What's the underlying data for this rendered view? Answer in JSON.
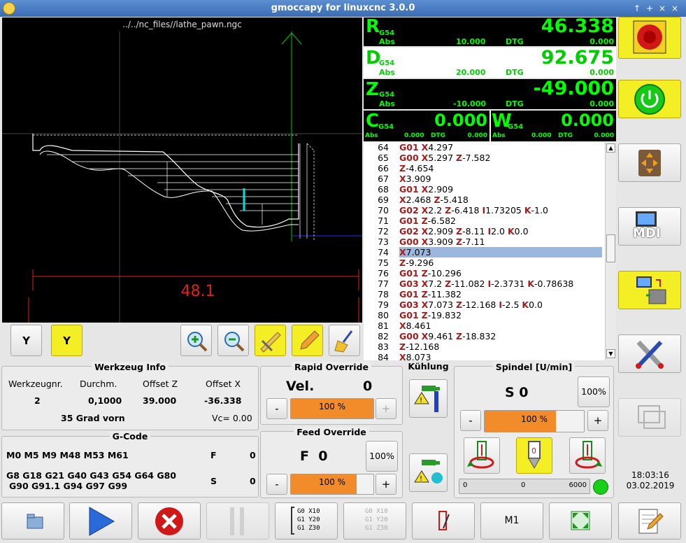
{
  "window": {
    "title": "gmoccapy for linuxcnc  3.0.0",
    "controls": [
      "↑",
      "+",
      "×",
      "×"
    ]
  },
  "preview": {
    "filename": "../../nc_files//lathe_pawn.ngc",
    "dimension": "48.1"
  },
  "dro": {
    "r": {
      "axis": "R",
      "coord": "G54",
      "abs_label": "Abs",
      "abs_value": "10.000",
      "dtg_label": "DTG",
      "value": "46.338",
      "dtg_value": "0.000"
    },
    "d": {
      "axis": "D",
      "coord": "G54",
      "abs_label": "Abs",
      "abs_value": "20.000",
      "dtg_label": "DTG",
      "value": "92.675",
      "dtg_value": "0.000"
    },
    "z": {
      "axis": "Z",
      "coord": "G54",
      "abs_label": "Abs",
      "abs_value": "-10.000",
      "dtg_label": "DTG",
      "value": "-49.000",
      "dtg_value": "0.000"
    },
    "c": {
      "axis": "C",
      "coord": "G54",
      "abs_label": "Abs",
      "abs_value": "0.000",
      "dtg_label": "DTG",
      "value": "0.000",
      "dtg_value": "0.000"
    },
    "w": {
      "axis": "W",
      "coord": "G54",
      "abs_label": "Abs",
      "abs_value": "0.000",
      "dtg_label": "DTG",
      "value": "0.000",
      "dtg_value": "0.000"
    }
  },
  "gcode_lines": [
    {
      "n": "64",
      "parts": [
        [
          "G01",
          "kw"
        ],
        [
          " ",
          ""
        ],
        [
          "X",
          "kw"
        ],
        [
          "4.297",
          ""
        ]
      ]
    },
    {
      "n": "65",
      "parts": [
        [
          "G00",
          "kw"
        ],
        [
          " ",
          ""
        ],
        [
          "X",
          "kw"
        ],
        [
          "5.297 ",
          ""
        ],
        [
          "Z",
          "kw"
        ],
        [
          "-7.582",
          ""
        ]
      ]
    },
    {
      "n": "66",
      "parts": [
        [
          "Z",
          "kw"
        ],
        [
          "-4.654",
          ""
        ]
      ]
    },
    {
      "n": "67",
      "parts": [
        [
          "X",
          "kw"
        ],
        [
          "3.909",
          ""
        ]
      ]
    },
    {
      "n": "68",
      "parts": [
        [
          "G01",
          "kw"
        ],
        [
          " ",
          ""
        ],
        [
          "X",
          "kw"
        ],
        [
          "2.909",
          ""
        ]
      ]
    },
    {
      "n": "69",
      "parts": [
        [
          "X",
          "kw"
        ],
        [
          "2.468 ",
          ""
        ],
        [
          "Z",
          "kw"
        ],
        [
          "-5.418",
          ""
        ]
      ]
    },
    {
      "n": "70",
      "parts": [
        [
          "G02",
          "kw"
        ],
        [
          " ",
          ""
        ],
        [
          "X",
          "kw"
        ],
        [
          "2.2 ",
          ""
        ],
        [
          "Z",
          "kw"
        ],
        [
          "-6.418 ",
          ""
        ],
        [
          "I",
          "kw"
        ],
        [
          "1.73205 ",
          ""
        ],
        [
          "K",
          "kw"
        ],
        [
          "-1.0",
          ""
        ]
      ]
    },
    {
      "n": "71",
      "parts": [
        [
          "G01",
          "kw"
        ],
        [
          " ",
          ""
        ],
        [
          "Z",
          "kw"
        ],
        [
          "-6.582",
          ""
        ]
      ]
    },
    {
      "n": "72",
      "parts": [
        [
          "G02",
          "kw"
        ],
        [
          " ",
          ""
        ],
        [
          "X",
          "kw"
        ],
        [
          "2.909 ",
          ""
        ],
        [
          "Z",
          "kw"
        ],
        [
          "-8.11 ",
          ""
        ],
        [
          "I",
          "kw"
        ],
        [
          "2.0 ",
          ""
        ],
        [
          "K",
          "kw"
        ],
        [
          "0.0",
          ""
        ]
      ]
    },
    {
      "n": "73",
      "parts": [
        [
          "G00",
          "kw"
        ],
        [
          " ",
          ""
        ],
        [
          "X",
          "kw"
        ],
        [
          "3.909 ",
          ""
        ],
        [
          "Z",
          "kw"
        ],
        [
          "-7.11",
          ""
        ]
      ]
    },
    {
      "n": "74",
      "parts": [
        [
          "X",
          "kw"
        ],
        [
          "7.073",
          ""
        ]
      ],
      "selected": true
    },
    {
      "n": "75",
      "parts": [
        [
          "Z",
          "kw"
        ],
        [
          "-9.296",
          ""
        ]
      ]
    },
    {
      "n": "76",
      "parts": [
        [
          "G01",
          "kw"
        ],
        [
          " ",
          ""
        ],
        [
          "Z",
          "kw"
        ],
        [
          "-10.296",
          ""
        ]
      ]
    },
    {
      "n": "77",
      "parts": [
        [
          "G03",
          "kw"
        ],
        [
          " ",
          ""
        ],
        [
          "X",
          "kw"
        ],
        [
          "7.2 ",
          ""
        ],
        [
          "Z",
          "kw"
        ],
        [
          "-11.082 ",
          ""
        ],
        [
          "I",
          "kw"
        ],
        [
          "-2.3731 ",
          ""
        ],
        [
          "K",
          "kw"
        ],
        [
          "-0.78638",
          ""
        ]
      ]
    },
    {
      "n": "78",
      "parts": [
        [
          "G01",
          "kw"
        ],
        [
          " ",
          ""
        ],
        [
          "Z",
          "kw"
        ],
        [
          "-11.382",
          ""
        ]
      ]
    },
    {
      "n": "79",
      "parts": [
        [
          "G03",
          "kw"
        ],
        [
          " ",
          ""
        ],
        [
          "X",
          "kw"
        ],
        [
          "7.073 ",
          ""
        ],
        [
          "Z",
          "kw"
        ],
        [
          "-12.168 ",
          ""
        ],
        [
          "I",
          "kw"
        ],
        [
          "-2.5 ",
          ""
        ],
        [
          "K",
          "kw"
        ],
        [
          "0.0",
          ""
        ]
      ]
    },
    {
      "n": "80",
      "parts": [
        [
          "G01",
          "kw"
        ],
        [
          " ",
          ""
        ],
        [
          "Z",
          "kw"
        ],
        [
          "-19.832",
          ""
        ]
      ]
    },
    {
      "n": "81",
      "parts": [
        [
          "X",
          "kw"
        ],
        [
          "8.461",
          ""
        ]
      ]
    },
    {
      "n": "82",
      "parts": [
        [
          "G00",
          "kw"
        ],
        [
          " ",
          ""
        ],
        [
          "X",
          "kw"
        ],
        [
          "9.461 ",
          ""
        ],
        [
          "Z",
          "kw"
        ],
        [
          "-18.832",
          ""
        ]
      ]
    },
    {
      "n": "83",
      "parts": [
        [
          "Z",
          "kw"
        ],
        [
          "-12.168",
          ""
        ]
      ]
    },
    {
      "n": "84",
      "parts": [
        [
          "X",
          "kw"
        ],
        [
          "8.073",
          ""
        ]
      ]
    }
  ],
  "tool_info": {
    "title": "Werkzeug Info",
    "h_toolnr": "Werkzeugnr.",
    "h_diam": "Durchm.",
    "h_offz": "Offset Z",
    "h_offx": "Offset X",
    "toolnr": "2",
    "diam": "0,1000",
    "offz": "39.000",
    "offx": "-36.338",
    "desc": "35 Grad vorn",
    "vc": "Vc= 0.00"
  },
  "gcode_panel": {
    "title": "G-Code",
    "mcodes": "M0 M5 M9 M48 M53 M61",
    "f_label": "F",
    "f_value": "0",
    "gcodes1": "G8 G18 G21 G40 G43 G54 G64 G80",
    "gcodes2": "G90 G91.1 G94 G97 G99",
    "s_label": "S",
    "s_value": "0"
  },
  "rapid": {
    "title": "Rapid Override",
    "vel_label": "Vel.",
    "vel_value": "0",
    "percent_text": "100 %",
    "level": 1.0,
    "minus": "-",
    "plus": "+"
  },
  "feed": {
    "title": "Feed Override",
    "f_label": "F  0",
    "reset": "100%",
    "percent_text": "100 %",
    "level": 0.8,
    "minus": "-",
    "plus": "+"
  },
  "cooling": {
    "title": "Kühlung"
  },
  "spindle": {
    "title": "Spindel [U/min]",
    "s_text": "S 0",
    "reset": "100%",
    "percent_text": "100 %",
    "level": 0.72,
    "minus": "-",
    "plus": "+",
    "bar_min": "0",
    "bar_val": "0",
    "bar_max": "6000"
  },
  "clock": {
    "time": "18:03:16",
    "date": "03.02.2019"
  },
  "view_buttons": {
    "y_label": "Y",
    "y2_label": "Y"
  },
  "bottom": {
    "gcode_btn_lines": [
      "G0 X10",
      "G1 Y20",
      "G1 Z30"
    ],
    "m1_label": "M1"
  },
  "side": {
    "mdi_label": "MDI"
  },
  "colors": {
    "dro_green": "#00ff00",
    "accent_yellow": "#f4ee24",
    "orange": "#f28c2a",
    "keyword": "#a41c1c"
  }
}
